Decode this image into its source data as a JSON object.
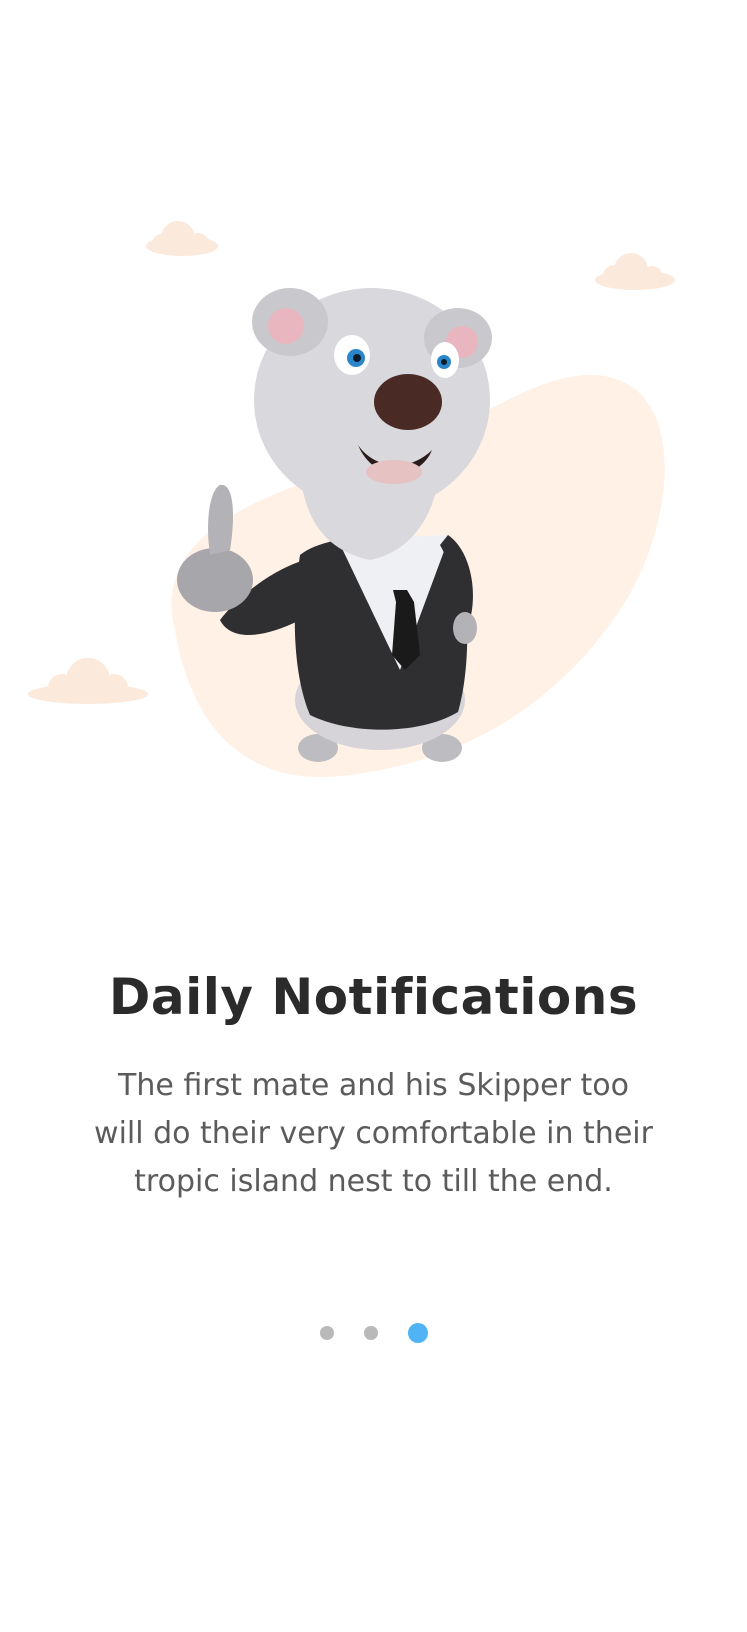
{
  "onboarding": {
    "title": "Daily Notifications",
    "description": "The first mate and his Skipper too will do their very comfortable in their tropic island nest to till the end.",
    "pages": [
      {
        "state": "inactive"
      },
      {
        "state": "inactive"
      },
      {
        "state": "active"
      }
    ],
    "active_page": 3,
    "page_count": 3
  },
  "colors": {
    "background": "#ffffff",
    "blob": "#fff1e6",
    "cloud": "#fbe9dc",
    "title": "#2b2b2b",
    "text": "#5b5b5b",
    "dot_inactive": "#b9b9b9",
    "dot_active": "#4fb3f6"
  }
}
